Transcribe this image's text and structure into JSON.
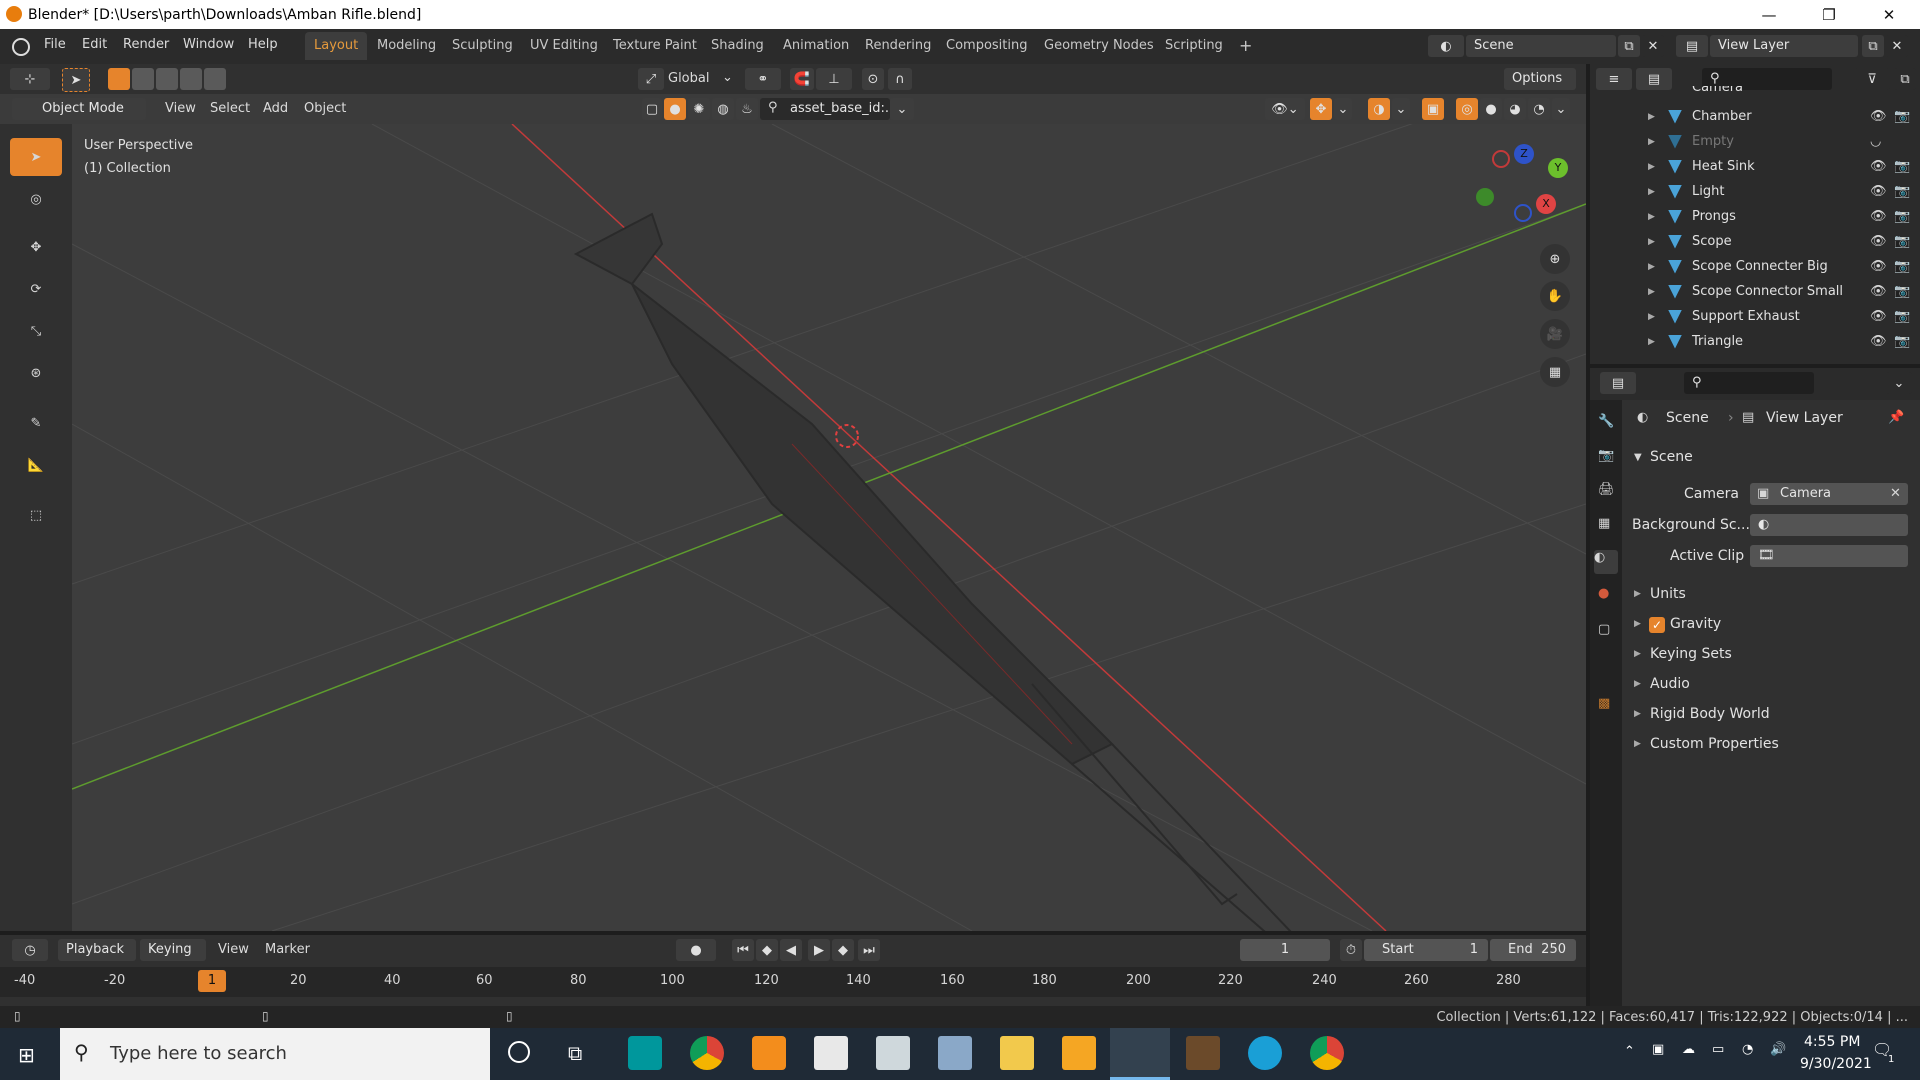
{
  "window": {
    "title": "Blender* [D:\\Users\\parth\\Downloads\\Amban Rifle.blend]",
    "minimize": "—",
    "maximize": "❐",
    "close": "✕"
  },
  "menus": [
    "File",
    "Edit",
    "Render",
    "Window",
    "Help"
  ],
  "workspaces": [
    "Layout",
    "Modeling",
    "Sculpting",
    "UV Editing",
    "Texture Paint",
    "Shading",
    "Animation",
    "Rendering",
    "Compositing",
    "Geometry Nodes",
    "Scripting"
  ],
  "add_workspace": "+",
  "scene_field": "Scene",
  "view_layer_field": "View Layer",
  "tool_header": {
    "orientation": "Global",
    "options": "Options"
  },
  "view_header": {
    "mode": "Object Mode",
    "view": "View",
    "select": "Select",
    "add": "Add",
    "object": "Object",
    "asset_search": "asset_base_id:..."
  },
  "viewport": {
    "label1": "User Perspective",
    "label2": "(1) Collection",
    "gizmo_z": "Z",
    "gizmo_y": "Y",
    "gizmo_x": "X"
  },
  "outliner": {
    "items": [
      {
        "name": "Camera"
      },
      {
        "name": "Chamber"
      },
      {
        "name": "Empty"
      },
      {
        "name": "Heat Sink"
      },
      {
        "name": "Light"
      },
      {
        "name": "Prongs"
      },
      {
        "name": "Scope"
      },
      {
        "name": "Scope Connecter Big"
      },
      {
        "name": "Scope Connector Small"
      },
      {
        "name": "Support Exhaust"
      },
      {
        "name": "Triangle"
      }
    ]
  },
  "properties": {
    "breadcrumb_scene": "Scene",
    "breadcrumb_sep": "›",
    "breadcrumb_viewlayer": "View Layer",
    "panel_title": "Scene",
    "camera_label": "Camera",
    "camera_value": "Camera",
    "bg_scene_label": "Background Sc...",
    "active_clip_label": "Active Clip",
    "sections": [
      "Units",
      "Gravity",
      "Keying Sets",
      "Audio",
      "Rigid Body World",
      "Custom Properties"
    ]
  },
  "timeline": {
    "playback": "Playback",
    "keying": "Keying",
    "view": "View",
    "marker": "Marker",
    "current_frame": "1",
    "start_label": "Start",
    "start_value": "1",
    "end_label": "End",
    "end_value": "250",
    "ticks": [
      "-40",
      "-20",
      "1",
      "20",
      "40",
      "60",
      "80",
      "100",
      "120",
      "140",
      "160",
      "180",
      "200",
      "220",
      "240",
      "260",
      "280"
    ]
  },
  "status": {
    "text": "Collection | Verts:61,122 | Faces:60,417 | Tris:122,922 | Objects:0/14 | ..."
  },
  "taskbar": {
    "search_placeholder": "Type here to search",
    "time": "4:55 PM",
    "date": "9/30/2021",
    "notif": "1"
  },
  "colors": {
    "accent": "#e6842c",
    "viewport_bg": "#3d3d3d",
    "panel": "#2b2b2b",
    "x_axis": "#c23a3a",
    "y_axis": "#5e9c2e"
  }
}
